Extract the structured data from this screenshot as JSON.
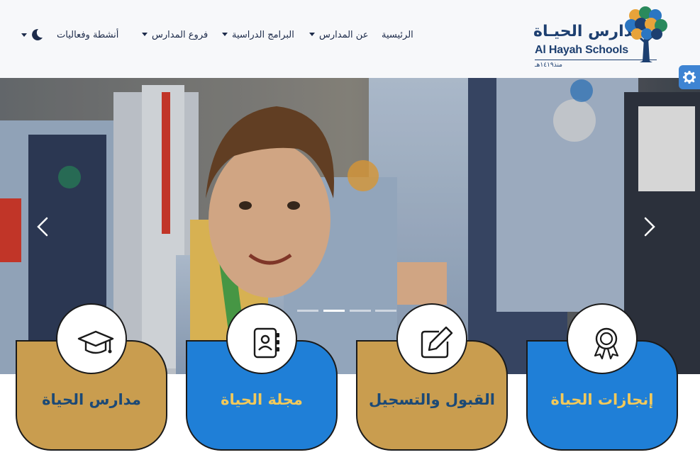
{
  "colors": {
    "brand_navy": "#1d3f70",
    "gold": "#c99d4f",
    "blue": "#1f7fd7",
    "accent_yellow": "#f2c95a",
    "settings_blue": "#3e84d3"
  },
  "logo": {
    "arabic_name": "مدارس الحيـاة",
    "english_name": "Al Hayah Schools",
    "since": "منذ١٤١٩هـ"
  },
  "nav": {
    "home": "الرئيسية",
    "about": "عن المدارس",
    "programs": "البرامج الدراسية",
    "branches": "فروع المدارس",
    "activities": "أنشطة وفعاليات",
    "theme_icon": "moon-icon"
  },
  "hero": {
    "slides_count": 4,
    "active_slide": 2,
    "prev_icon": "chevron-left-icon",
    "next_icon": "chevron-right-icon"
  },
  "cards": [
    {
      "title": "مدارس الحياة",
      "icon": "graduation-cap-icon",
      "theme": "gold"
    },
    {
      "title": "مجلة الحياة",
      "icon": "address-book-icon",
      "theme": "blue"
    },
    {
      "title": "القبول والتسجيل",
      "icon": "edit-pen-icon",
      "theme": "gold"
    },
    {
      "title": "إنجازات الحياة",
      "icon": "award-badge-icon",
      "theme": "blue"
    }
  ],
  "settings": {
    "icon": "gear-icon"
  }
}
